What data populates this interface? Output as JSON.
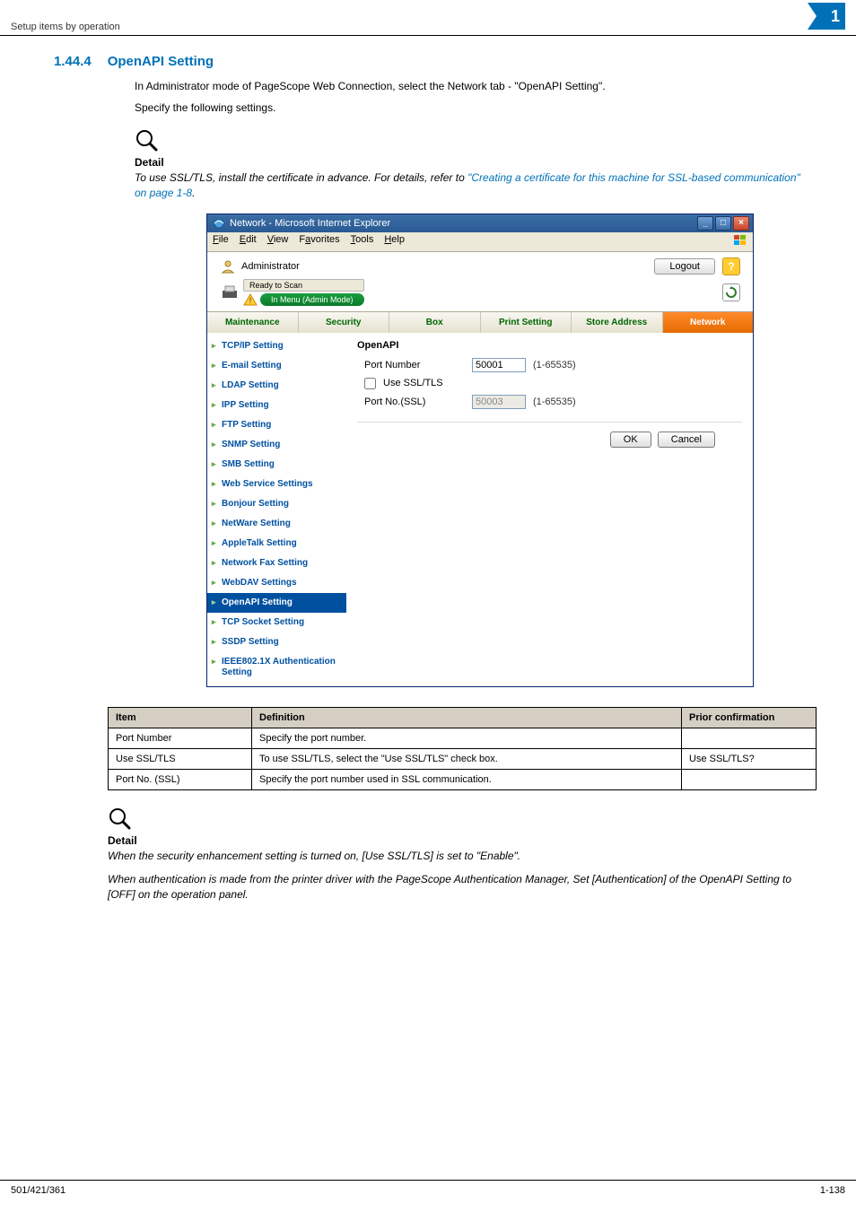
{
  "header": {
    "left": "Setup items by operation",
    "chapter": "1"
  },
  "section": {
    "number": "1.44.4",
    "title": "OpenAPI Setting"
  },
  "para1": "In Administrator mode of PageScope Web Connection, select the Network tab - \"OpenAPI Setting\".",
  "para2": "Specify the following settings.",
  "detail1": {
    "label": "Detail",
    "text_prefix": "To use SSL/TLS, install the certificate in advance. For details, refer to ",
    "link": "\"Creating a certificate for this machine for SSL-based communication\" on page 1-8",
    "text_suffix": "."
  },
  "browser": {
    "title": "Network - Microsoft Internet Explorer",
    "menus": {
      "file": "File",
      "edit": "Edit",
      "view": "View",
      "favorites": "Favorites",
      "tools": "Tools",
      "help": "Help"
    },
    "admin_label": "Administrator",
    "logout": "Logout",
    "ready": "Ready to Scan",
    "in_menu": "In Menu (Admin Mode)",
    "tabs": {
      "maintenance": "Maintenance",
      "security": "Security",
      "box": "Box",
      "print": "Print Setting",
      "store": "Store Address",
      "network": "Network"
    },
    "nav": {
      "tcpip": "TCP/IP Setting",
      "email": "E-mail Setting",
      "ldap": "LDAP Setting",
      "ipp": "IPP Setting",
      "ftp": "FTP Setting",
      "snmp": "SNMP Setting",
      "smb": "SMB Setting",
      "websvc": "Web Service Settings",
      "bonjour": "Bonjour Setting",
      "netware": "NetWare Setting",
      "appletalk": "AppleTalk Setting",
      "netfax": "Network Fax Setting",
      "webdav": "WebDAV Settings",
      "openapi": "OpenAPI Setting",
      "tcpsocket": "TCP Socket Setting",
      "ssdp": "SSDP Setting",
      "ieee": "IEEE802.1X Authentication Setting"
    },
    "pane": {
      "title": "OpenAPI",
      "port_label": "Port Number",
      "port_value": "50001",
      "port_range": "(1-65535)",
      "ssl_label": "Use SSL/TLS",
      "portssl_label": "Port No.(SSL)",
      "portssl_value": "50003",
      "portssl_range": "(1-65535)",
      "ok": "OK",
      "cancel": "Cancel"
    }
  },
  "table": {
    "headers": {
      "item": "Item",
      "definition": "Definition",
      "prior": "Prior confirmation"
    },
    "rows": [
      {
        "item": "Port Number",
        "definition": "Specify the port number.",
        "prior": ""
      },
      {
        "item": "Use SSL/TLS",
        "definition": "To use SSL/TLS, select the \"Use SSL/TLS\" check box.",
        "prior": "Use SSL/TLS?"
      },
      {
        "item": "Port No. (SSL)",
        "definition": "Specify the port number used in SSL communication.",
        "prior": ""
      }
    ]
  },
  "detail2": {
    "label": "Detail",
    "line1": "When the security enhancement setting is turned on, [Use SSL/TLS] is set to \"Enable\".",
    "line2": "When authentication is made from the printer driver with the PageScope Authentication Manager, Set [Authentication] of the OpenAPI Setting to [OFF] on the operation panel."
  },
  "footer": {
    "left": "501/421/361",
    "right": "1-138"
  }
}
